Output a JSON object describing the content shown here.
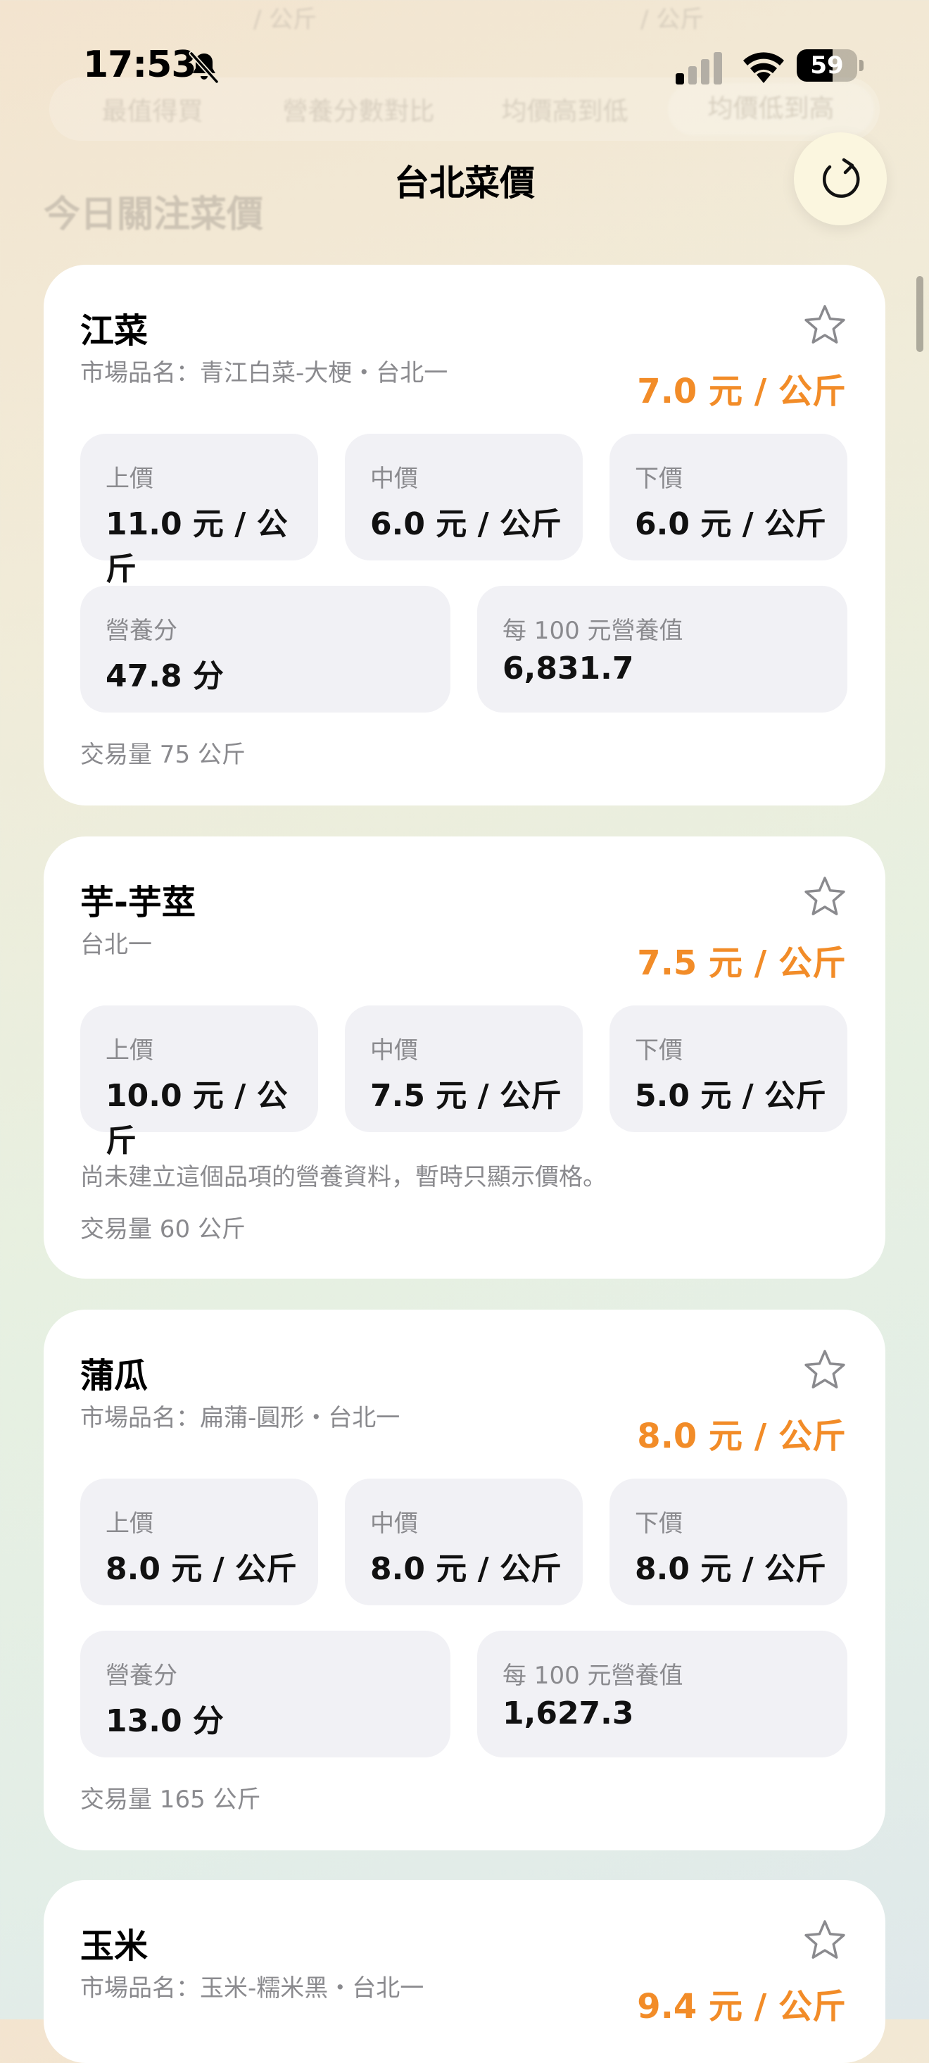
{
  "background_hint": {
    "units": [
      "/ 公斤",
      "/ 公斤"
    ],
    "filter_tabs": [
      "最值得買",
      "營養分數對比",
      "均價高到低",
      "均價低到高"
    ],
    "section_title": "今日關注菜價"
  },
  "status_bar": {
    "time": "17:53",
    "battery": "59",
    "battery_level": 0.59
  },
  "nav": {
    "title": "台北菜價"
  },
  "labels": {
    "high": "上價",
    "mid": "中價",
    "low": "下價",
    "nutrition_score": "營養分",
    "value_per_100": "每 100 元營養值"
  },
  "cards": [
    {
      "name": "江菜",
      "subtitle": "市場品名：青江白菜-大梗・台北一",
      "price": "7.0 元 / 公斤",
      "high": "11.0 元 / 公斤",
      "mid": "6.0 元 / 公斤",
      "low": "6.0 元 / 公斤",
      "nutrition_score": "47.8 分",
      "value_per_100": "6,831.7",
      "volume": "交易量 75 公斤"
    },
    {
      "name": "芋-芋莖",
      "subtitle": "台北一",
      "price": "7.5 元 / 公斤",
      "high": "10.0 元 / 公斤",
      "mid": "7.5 元 / 公斤",
      "low": "5.0 元 / 公斤",
      "note": "尚未建立這個品項的營養資料，暫時只顯示價格。",
      "volume": "交易量 60 公斤"
    },
    {
      "name": "蒲瓜",
      "subtitle": "市場品名：扁蒲-圓形・台北一",
      "price": "8.0 元 / 公斤",
      "high": "8.0 元 / 公斤",
      "mid": "8.0 元 / 公斤",
      "low": "8.0 元 / 公斤",
      "nutrition_score": "13.0 分",
      "value_per_100": "1,627.3",
      "volume": "交易量 165 公斤"
    },
    {
      "name": "玉米",
      "subtitle": "市場品名：玉米-糯米黑・台北一",
      "price": "9.4 元 / 公斤"
    }
  ]
}
